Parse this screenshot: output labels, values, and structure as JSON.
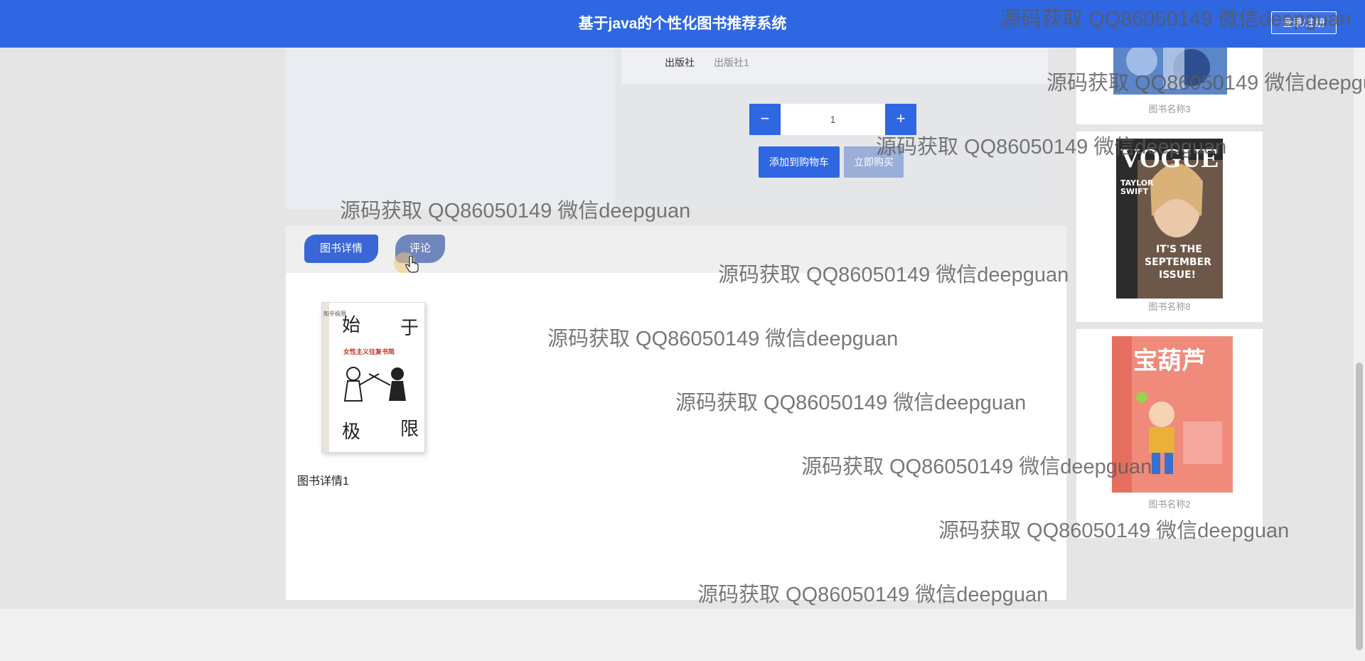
{
  "header": {
    "title": "基于java的个性化图书推荐系统",
    "login_label": "登录/注册"
  },
  "product": {
    "publisher_label": "出版社",
    "publisher_value": "出版社1",
    "quantity": "1",
    "minus_symbol": "−",
    "plus_symbol": "+",
    "add_to_cart_label": "添加到购物车",
    "buy_now_label": "立即购买"
  },
  "tabs": [
    {
      "label": "图书详情"
    },
    {
      "label": "评论"
    }
  ],
  "details": {
    "cover_title_chars": [
      "始",
      "于",
      "极",
      "限"
    ],
    "cover_subtitle": "女性主义往复书简",
    "cover_top_label": "知乎极限",
    "text": "图书详情1"
  },
  "sidebar": {
    "items": [
      {
        "caption": "图书名称3"
      },
      {
        "caption": "图书名称8"
      },
      {
        "caption": "图书名称2"
      }
    ]
  },
  "vogue_cover": {
    "masthead": "VOGUE",
    "line1": "TAYLOR",
    "line2": "SWIFT",
    "line3": "IT'S THE",
    "line4": "SEPTEMBER",
    "line5": "ISSUE!"
  },
  "gourd_cover": {
    "title": "宝葫芦"
  },
  "watermark_text": "源码获取 QQ86050149 微信deepguan",
  "colors": {
    "primary": "#2f67e2",
    "accent_muted": "#9aaed8"
  }
}
